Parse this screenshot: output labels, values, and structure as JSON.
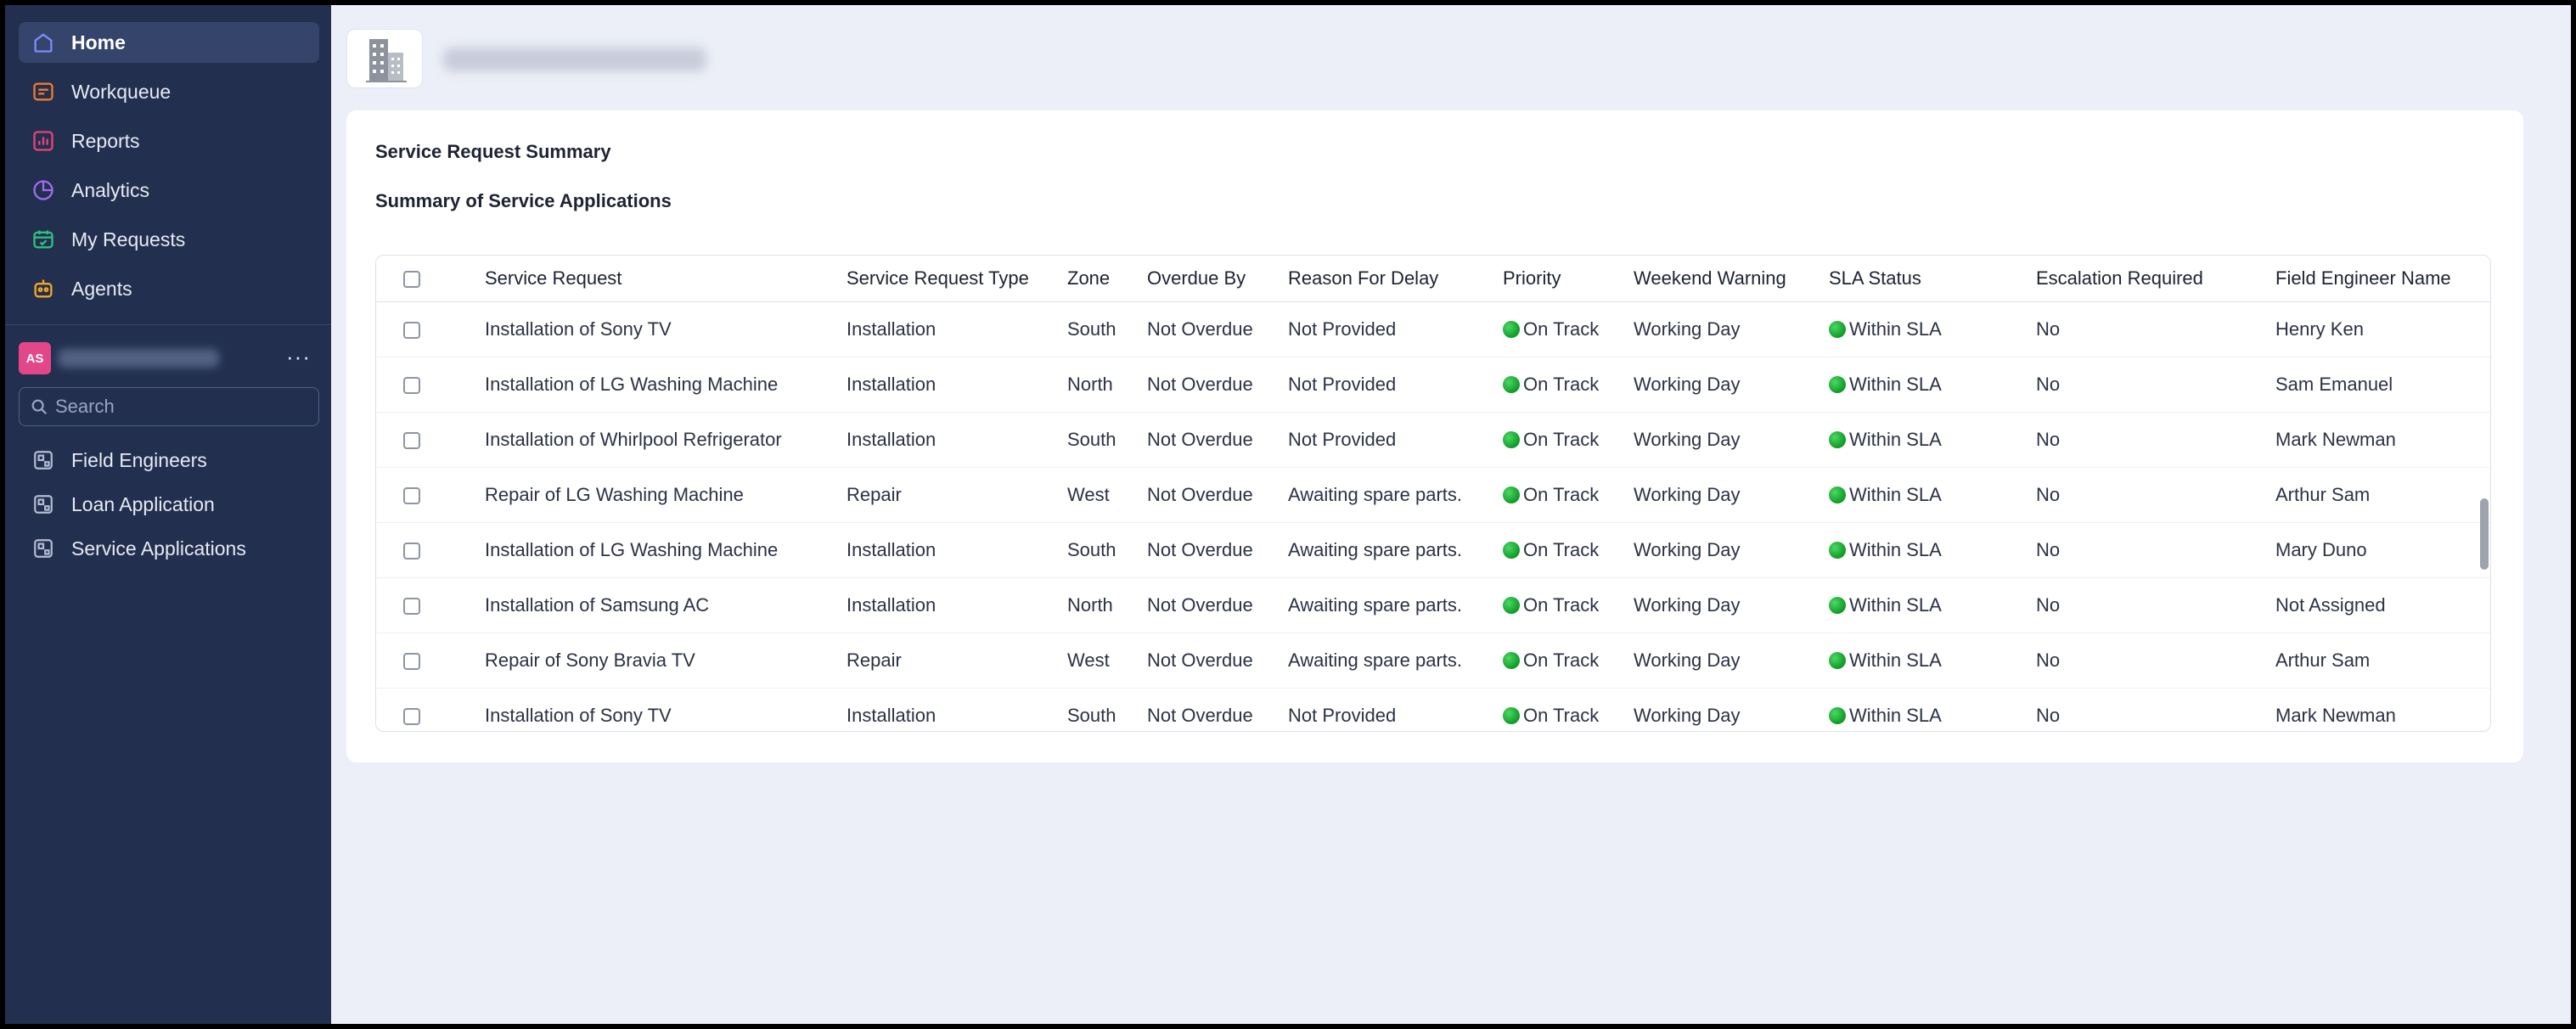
{
  "sidebar": {
    "nav": [
      {
        "label": "Home",
        "icon": "home-icon",
        "color": "#7b8cff"
      },
      {
        "label": "Workqueue",
        "icon": "workqueue-icon",
        "color": "#f07a2e"
      },
      {
        "label": "Reports",
        "icon": "reports-icon",
        "color": "#e5457a"
      },
      {
        "label": "Analytics",
        "icon": "analytics-icon",
        "color": "#a06cf0"
      },
      {
        "label": "My Requests",
        "icon": "my-requests-icon",
        "color": "#2fc07f"
      },
      {
        "label": "Agents",
        "icon": "agents-icon",
        "color": "#f5a623"
      }
    ],
    "workspace": {
      "initials": "AS",
      "more_label": "···"
    },
    "search": {
      "placeholder": "Search"
    },
    "apps": [
      {
        "label": "Field Engineers",
        "icon": "app-icon"
      },
      {
        "label": "Loan Application",
        "icon": "app-icon"
      },
      {
        "label": "Service Applications",
        "icon": "app-icon"
      }
    ]
  },
  "main": {
    "card_title": "Service Request Summary",
    "card_subtitle": "Summary of Service Applications",
    "table": {
      "columns": [
        "Service Request",
        "Service Request Type",
        "Zone",
        "Overdue By",
        "Reason For Delay",
        "Priority",
        "Weekend Warning",
        "SLA Status",
        "Escalation Required",
        "Field Engineer Name"
      ],
      "rows": [
        [
          "Installation of Sony TV",
          "Installation",
          "South",
          "Not Overdue",
          "Not Provided",
          "On Track",
          "Working Day",
          "Within SLA",
          "No",
          "Henry Ken"
        ],
        [
          "Installation of LG Washing Machine",
          "Installation",
          "North",
          "Not Overdue",
          "Not Provided",
          "On Track",
          "Working Day",
          "Within SLA",
          "No",
          "Sam Emanuel"
        ],
        [
          "Installation of Whirlpool Refrigerator",
          "Installation",
          "South",
          "Not Overdue",
          "Not Provided",
          "On Track",
          "Working Day",
          "Within SLA",
          "No",
          "Mark Newman"
        ],
        [
          "Repair of LG Washing Machine",
          "Repair",
          "West",
          "Not Overdue",
          "Awaiting spare parts.",
          "On Track",
          "Working Day",
          "Within SLA",
          "No",
          "Arthur Sam"
        ],
        [
          "Installation of LG Washing Machine",
          "Installation",
          "South",
          "Not Overdue",
          "Awaiting spare parts.",
          "On Track",
          "Working Day",
          "Within SLA",
          "No",
          "Mary Duno"
        ],
        [
          "Installation of Samsung AC",
          "Installation",
          "North",
          "Not Overdue",
          "Awaiting spare parts.",
          "On Track",
          "Working Day",
          "Within SLA",
          "No",
          "Not Assigned"
        ],
        [
          "Repair of Sony Bravia TV",
          "Repair",
          "West",
          "Not Overdue",
          "Awaiting spare parts.",
          "On Track",
          "Working Day",
          "Within SLA",
          "No",
          "Arthur Sam"
        ],
        [
          "Installation of Sony TV",
          "Installation",
          "South",
          "Not Overdue",
          "Not Provided",
          "On Track",
          "Working Day",
          "Within SLA",
          "No",
          "Mark Newman"
        ]
      ],
      "status_color": "#16b832"
    }
  }
}
